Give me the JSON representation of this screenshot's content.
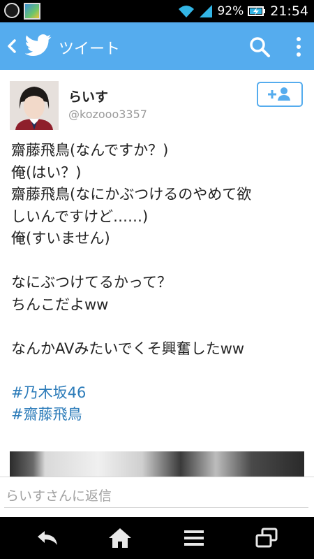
{
  "status_bar": {
    "battery": "92%",
    "time": "21:54",
    "icons": [
      "notification-circle-icon",
      "photo-icon",
      "wifi-icon",
      "signal-icon",
      "battery-charging-icon"
    ]
  },
  "app_bar": {
    "title": "ツイート",
    "color": "#55acee",
    "icons": [
      "back-icon",
      "twitter-bird-icon",
      "search-icon",
      "more-vertical-icon"
    ]
  },
  "tweet": {
    "display_name": "らいす",
    "handle": "@kozooo3357",
    "lines": [
      "齋藤飛鳥(なんですか？)",
      "俺(はい？)",
      "齋藤飛鳥(なにかぶつけるのやめて欲",
      "しいんですけど……)",
      "俺(すいません)",
      "",
      "なにぶつけてるかって？",
      "ちんこだよww",
      "",
      "なんかAVみたいでくそ興奮したww",
      ""
    ],
    "hashtags": [
      {
        "hash": "#",
        "text": "乃木坂46"
      },
      {
        "hash": "#",
        "text": "齋藤飛鳥"
      }
    ],
    "hashtag_color": "#2b7bb9"
  },
  "reply": {
    "placeholder": "らいすさんに返信"
  },
  "nav_bar": {
    "icons": [
      "back-arrow-icon",
      "home-icon",
      "menu-icon",
      "recent-apps-icon"
    ]
  }
}
